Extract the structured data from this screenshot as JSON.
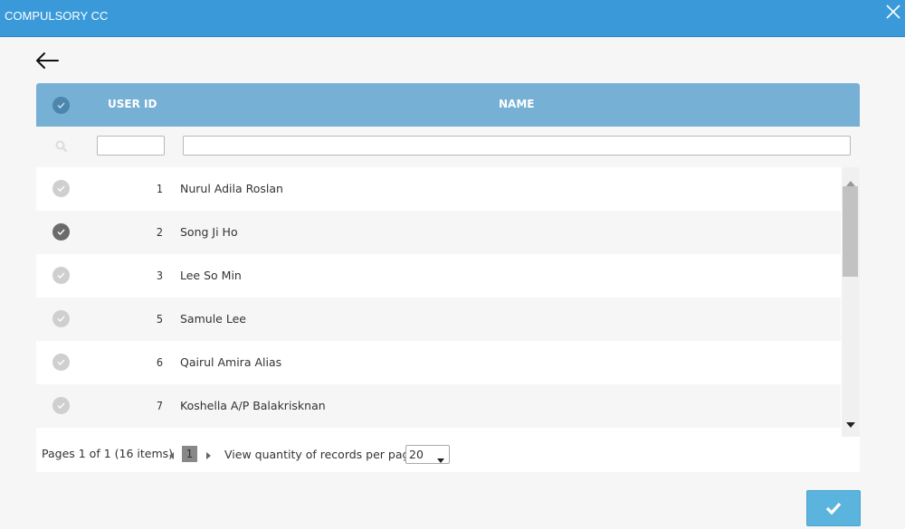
{
  "dialog": {
    "title": "COMPULSORY CC"
  },
  "grid": {
    "columns": {
      "user_id": "USER ID",
      "name": "NAME"
    },
    "filters": {
      "user_id_value": "",
      "name_value": ""
    },
    "rows": [
      {
        "id": "1",
        "name": "Nurul Adila Roslan",
        "checked": false
      },
      {
        "id": "2",
        "name": "Song Ji Ho",
        "checked": true
      },
      {
        "id": "3",
        "name": "Lee So Min",
        "checked": false
      },
      {
        "id": "5",
        "name": "Samule Lee",
        "checked": false
      },
      {
        "id": "6",
        "name": "Qairul Amira Alias",
        "checked": false
      },
      {
        "id": "7",
        "name": "Koshella A/P Balakrisknan",
        "checked": false
      }
    ]
  },
  "pager": {
    "info": "Pages 1 of 1 (16 items)",
    "current_page": "1",
    "per_page_label": "View quantity of records per page",
    "per_page_value": "20"
  },
  "icons": {
    "close": "close-icon",
    "back": "arrow-left-icon",
    "search": "search-icon",
    "confirm": "checkmark-icon"
  },
  "colors": {
    "titlebar": "#3a9ad9",
    "header": "#76b0d4",
    "checked": "#6b6b6b",
    "unchecked": "#cfcfcf",
    "confirm_button": "#5bb4dd"
  }
}
